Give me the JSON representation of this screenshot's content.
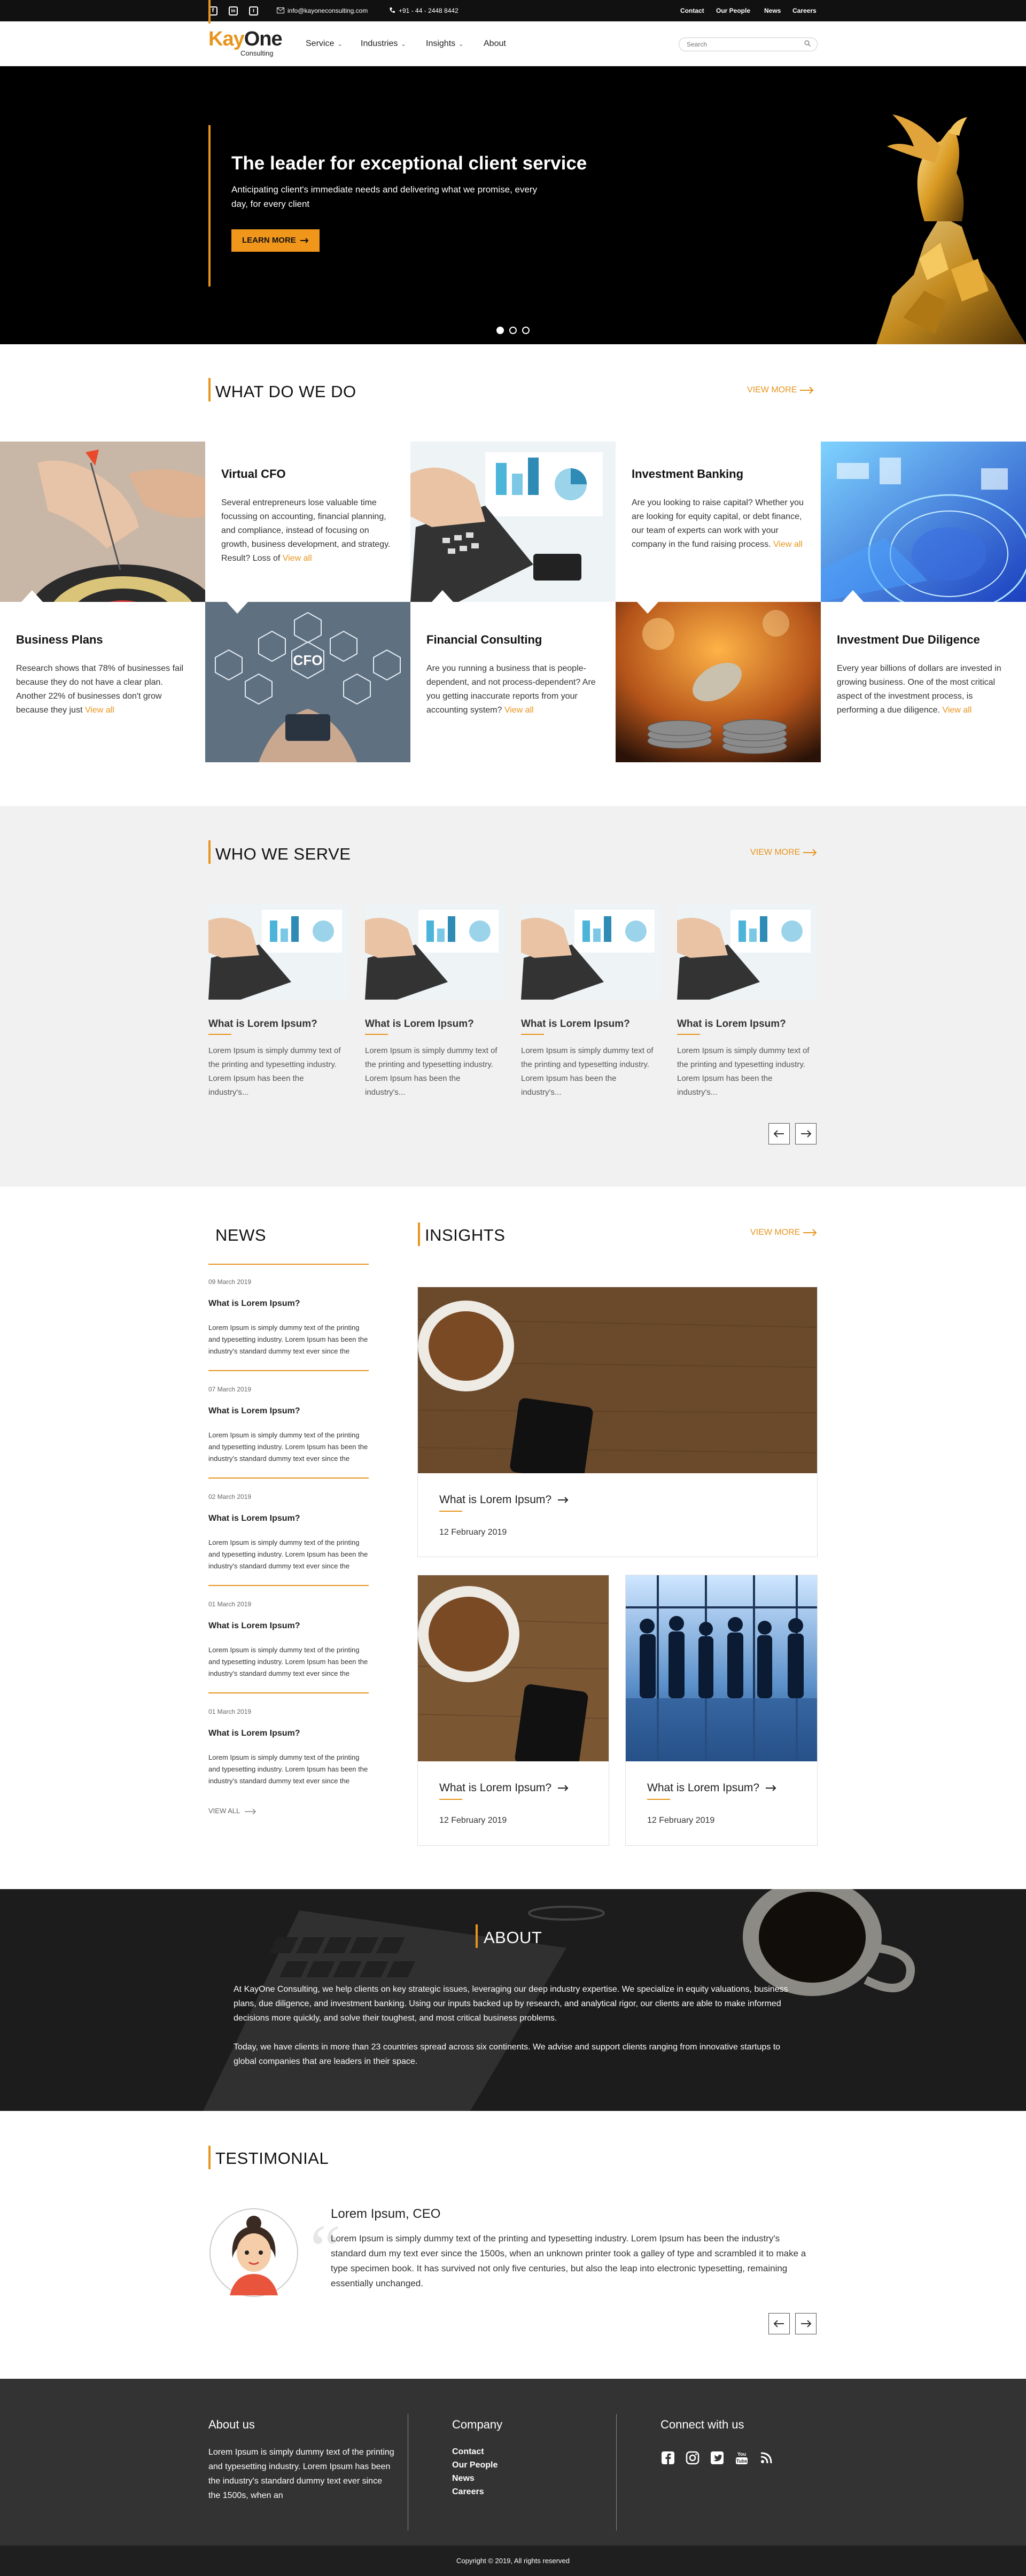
{
  "topbar": {
    "email": "info@kayoneconsulting.com",
    "phone": "+91 - 44 - 2448 8442",
    "links": [
      "Contact",
      "Our People",
      "News",
      "Careers"
    ],
    "social": [
      "facebook-icon",
      "linkedin-icon",
      "twitter-icon"
    ]
  },
  "brand": {
    "name_k": "Kay",
    "name_rest": "One",
    "sub": "Consulting",
    "accent": "#e8941e"
  },
  "nav": {
    "items": [
      "Service",
      "Industries",
      "Insights",
      "About"
    ],
    "search_placeholder": "Search"
  },
  "hero": {
    "title": "The leader for exceptional client service",
    "subtitle": "Anticipating client's immediate needs and delivering what we promise, every day, for every client",
    "cta": "LEARN MORE",
    "slides_total": 3,
    "slide_active": 1
  },
  "what_we_do": {
    "title": "WHAT DO WE DO",
    "view_more": "VIEW MORE",
    "services": [
      {
        "title": "Virtual CFO",
        "text": "Several entrepreneurs lose valuable time focussing on accounting, financial plan­ning, and compliance, instead of focusing on growth, business development, and strategy. Result? Loss of",
        "link": "View all"
      },
      {
        "title": "Investment Banking",
        "text": "Are you looking to raise capital? Whether you are looking for equity capital, or debt finance, our team of experts can work with your company in the fund raising process.",
        "link": "View all"
      },
      {
        "title": "Business Plans",
        "text": "Research shows that 78% of businesses fail because they do not have a clear plan. Another 22% of businesses don't grow because they just",
        "link": "View all"
      },
      {
        "title": "Financial Consulting",
        "text": "Are you running a business that is peo­ple-dependent, and not process-depend­ent? Are you getting inaccurate reports from your accounting system?",
        "link": "View all"
      },
      {
        "title": "Investment Due Diligence",
        "text": "Every year billions of dollars are invested in growing business. One of the most critical aspect of the investment process, is performing a due diligence.",
        "link": "View all"
      }
    ],
    "cfo_label": "CFO"
  },
  "who_we_serve": {
    "title": "WHO WE SERVE",
    "view_more": "VIEW MORE",
    "cards": [
      {
        "title": "What is Lorem Ipsum?",
        "text": "Lorem Ipsum is simply dummy text of the printing and type­setting industry. Lorem Ipsum has been the industry's..."
      },
      {
        "title": "What is Lorem Ipsum?",
        "text": "Lorem Ipsum is simply dummy text of the printing and type­setting industry. Lorem Ipsum has been the industry's..."
      },
      {
        "title": "What is Lorem Ipsum?",
        "text": "Lorem Ipsum is simply dummy text of the printing and type­setting industry. Lorem Ipsum has been the industry's..."
      },
      {
        "title": "What is Lorem Ipsum?",
        "text": "Lorem Ipsum is simply dummy text of the printing and type­setting industry. Lorem Ipsum has been the industry's..."
      }
    ]
  },
  "news": {
    "title": "NEWS",
    "items": [
      {
        "date": "09 March 2019",
        "title": "What is Lorem Ipsum?",
        "text": "Lorem Ipsum is simply dummy text of the printing and typesetting industry. Lorem Ipsum has been the industry's standard dummy text ever since the"
      },
      {
        "date": "07 March 2019",
        "title": "What is Lorem Ipsum?",
        "text": "Lorem Ipsum is simply dummy text of the printing and typesetting industry. Lorem Ipsum has been the industry's standard dummy text ever since the"
      },
      {
        "date": "02 March 2019",
        "title": "What is Lorem Ipsum?",
        "text": "Lorem Ipsum is simply dummy text of the printing and typesetting industry. Lorem Ipsum has been the industry's standard dummy text ever since the"
      },
      {
        "date": "01 March 2019",
        "title": "What is Lorem Ipsum?",
        "text": "Lorem Ipsum is simply dummy text of the printing and typesetting industry. Lorem Ipsum has been the industry's standard dummy text ever since the"
      },
      {
        "date": "01 March 2019",
        "title": "What is Lorem Ipsum?",
        "text": "Lorem Ipsum is simply dummy text of the printing and typesetting industry. Lorem Ipsum has been the industry's standard dummy text ever since the"
      }
    ],
    "view_all": "VIEW ALL"
  },
  "insights": {
    "title": "INSIGHTS",
    "view_more": "VIEW MORE",
    "items": [
      {
        "title": "What is Lorem Ipsum?",
        "date": "12 February 2019"
      },
      {
        "title": "What is Lorem Ipsum?",
        "date": "12 February 2019"
      },
      {
        "title": "What is Lorem Ipsum?",
        "date": "12 February 2019"
      }
    ]
  },
  "about": {
    "title": "ABOUT",
    "para1": "At KayOne Consulting, we help clients on key strategic issues, leveraging our deep industry expertise. We specialize in equity valua­tions, business plans, due diligence, and investment banking. Using our inputs backed up by research, and analytical rigor, our cli­ents are able to make informed decisions more quickly, and solve their toughest, and most critical business problems.",
    "para2": "Today, we have clients in more than 23 countries spread across six continents. We advise and support clients ranging from innova­tive startups to global companies that are leaders in their space."
  },
  "testimonial": {
    "title": "TESTIMONIAL",
    "name": "Lorem Ipsum, CEO",
    "text": "Lorem Ipsum is simply dummy text of the printing and typesetting industry. Lorem Ipsum has been the industry's standard dum my text ever since the 1500s, when an unknown printer took a galley of type and scrambled it to make a type specimen book. It has survived not only five centuries, but also the leap into electronic typesetting, remaining essentially unchanged."
  },
  "footer": {
    "about_title": "About us",
    "about_text": "Lorem Ipsum is simply dummy text of the printing and typesetting industry. Lorem Ipsum has been the industry's standard dummy text ever since the 1500s, when an",
    "company_title": "Company",
    "company_links": [
      "Contact",
      "Our People",
      "News",
      "Careers"
    ],
    "connect_title": "Connect with us",
    "social": [
      "facebook-icon",
      "instagram-icon",
      "twitter-icon",
      "youtube-icon",
      "rss-icon"
    ],
    "copyright": "Copyright © 2019, All rights reserved"
  }
}
